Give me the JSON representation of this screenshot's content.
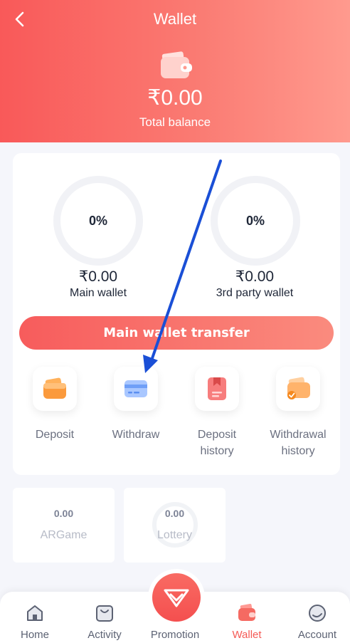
{
  "header": {
    "title": "Wallet",
    "total_amount": "₹0.00",
    "total_label": "Total balance"
  },
  "wallets": [
    {
      "percent": "0%",
      "amount": "₹0.00",
      "name": "Main wallet"
    },
    {
      "percent": "0%",
      "amount": "₹0.00",
      "name": "3rd party wallet"
    }
  ],
  "transfer_label": "Main wallet transfer",
  "actions": [
    {
      "label_line1": "Deposit",
      "label_line2": ""
    },
    {
      "label_line1": "Withdraw",
      "label_line2": ""
    },
    {
      "label_line1": "Deposit",
      "label_line2": "history"
    },
    {
      "label_line1": "Withdrawal",
      "label_line2": "history"
    }
  ],
  "games": [
    {
      "amount": "0.00",
      "name": "ARGame"
    },
    {
      "amount": "0.00",
      "name": "Lottery"
    }
  ],
  "nav": [
    {
      "label": "Home"
    },
    {
      "label": "Activity"
    },
    {
      "label": "Promotion"
    },
    {
      "label": "Wallet"
    },
    {
      "label": "Account"
    }
  ],
  "colors": {
    "accent": "#f95959",
    "accent_light": "#ff9a8e",
    "arrow": "#1a4fd6",
    "active_nav": "#f55a55"
  }
}
